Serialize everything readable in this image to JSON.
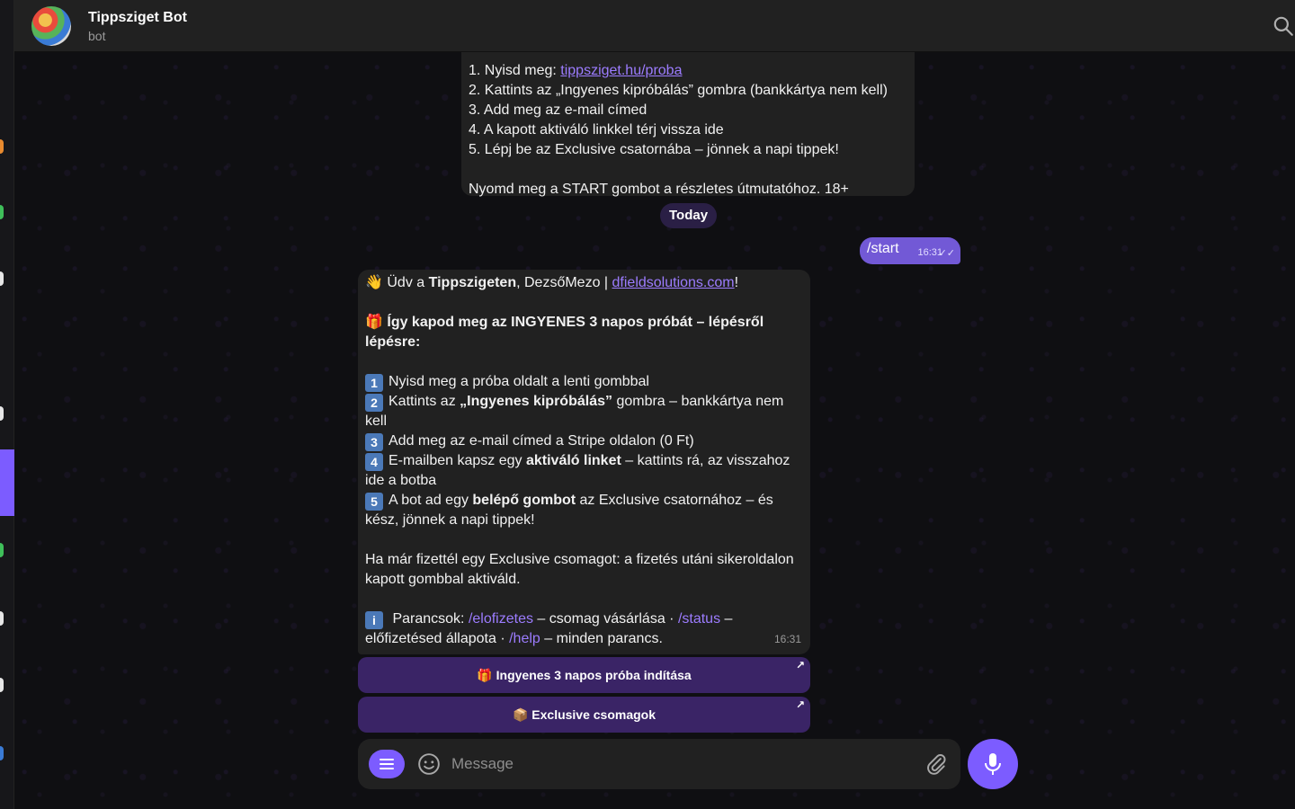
{
  "header": {
    "title": "Tippsziget Bot",
    "subtitle": "bot"
  },
  "previous_message": {
    "lines": [
      "1. Nyisd meg: ",
      "2. Kattints az „Ingyenes kipróbálás” gombra (bankkártya nem kell)",
      "3. Add meg az e-mail címed",
      "4. A kapott aktiváló linkkel térj vissza ide",
      "5. Lépj be az Exclusive csatornába – jönnek a napi tippek!"
    ],
    "link": "tippsziget.hu/proba",
    "footer": "Nyomd meg a START gombot a részletes útmutatóhoz. 18+"
  },
  "date_separator": "Today",
  "outgoing": {
    "text": "/start",
    "time": "16:31"
  },
  "bot_message": {
    "greet_emoji": "👋",
    "greet_pre": " Üdv a ",
    "greet_bold": "Tippszigeten",
    "greet_mid": ", DezsőMezo | ",
    "greet_link": "dfieldsolutions.com",
    "greet_end": "!",
    "headline_emoji": "🎁",
    "headline": " Így kapod meg az INGYENES 3 napos próbát – lépésről lépésre:",
    "steps": {
      "n1": "1",
      "s1": "Nyisd meg a próba oldalt a lenti gombbal",
      "n2": "2",
      "s2_pre": "Kattints az ",
      "s2_bold": "„Ingyenes kipróbálás”",
      "s2_post": " gombra – bankkártya nem kell",
      "n3": "3",
      "s3": "Add meg az e-mail címed a Stripe oldalon (0 Ft)",
      "n4": "4",
      "s4_pre": "E-mailben kapsz egy ",
      "s4_bold": "aktiváló linket",
      "s4_post": " – kattints rá, az visszahoz ide a botba",
      "n5": "5",
      "s5_pre": "A bot ad egy ",
      "s5_bold": "belépő gombot",
      "s5_post": " az Exclusive csatornához – és kész, jönnek a napi tippek!"
    },
    "paid_note": "Ha már fizettél egy Exclusive csomagot: a fizetés utáni sikeroldalon kapott gombbal aktiváld.",
    "commands_icon": "i",
    "commands_pre": " Parancsok: ",
    "cmd1": "/elofizetes",
    "cmd1_desc": " – csomag vásárlása · ",
    "cmd2": "/status",
    "cmd2_desc": " – előfizetésed állapota · ",
    "cmd3": "/help",
    "cmd3_desc": " – minden parancs.",
    "time": "16:31"
  },
  "keyboard": {
    "btn1_emoji": "🎁",
    "btn1": "Ingyenes 3 napos próba indítása",
    "btn2_emoji": "📦",
    "btn2": "Exclusive csomagok",
    "arrow": "↗"
  },
  "composer": {
    "placeholder": "Message"
  },
  "icons": {
    "search": "search-icon",
    "menu": "menu-icon",
    "emoji": "smile-icon",
    "attach": "paperclip-icon",
    "mic": "microphone-icon",
    "read": "double-check-icon"
  },
  "colors": {
    "accent": "#7c5cff",
    "outgoing_bubble": "#7259d6",
    "incoming_bubble": "#212121",
    "link": "#9c7cff",
    "inline_button": "#3a2466"
  }
}
